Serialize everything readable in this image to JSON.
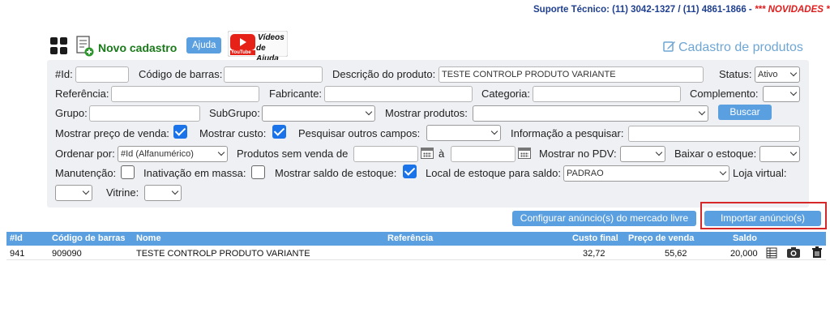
{
  "support": {
    "label": "Suporte Técnico: (11) 3042-1327 / (11) 4861-1866 - ",
    "news": "*** NOVIDADES ***"
  },
  "toolbar": {
    "new_label": "Novo cadastro",
    "help_label": "Ajuda",
    "videos_brand": "YouTube",
    "videos_line1": "Vídeos",
    "videos_line2": "de Ajuda"
  },
  "page_title": "Cadastro de produtos",
  "filters": {
    "id_label": "#Id:",
    "barcode_label": "Código de barras:",
    "description_label": "Descrição do produto:",
    "description_value": "TESTE CONTROLP PRODUTO VARIANTE",
    "status_label": "Status:",
    "status_value": "Ativo",
    "reference_label": "Referência:",
    "manufacturer_label": "Fabricante:",
    "category_label": "Categoria:",
    "complement_label": "Complemento:",
    "group_label": "Grupo:",
    "subgroup_label": "SubGrupo:",
    "show_products_label": "Mostrar produtos:",
    "search_button": "Buscar",
    "show_sale_price_label": "Mostrar preço de venda:",
    "show_sale_price": true,
    "show_cost_label": "Mostrar custo:",
    "show_cost": true,
    "search_other_label": "Pesquisar outros campos:",
    "info_search_label": "Informação a pesquisar:",
    "order_by_label": "Ordenar por:",
    "order_by_value": "#Id (Alfanumérico)",
    "no_sale_label": "Produtos sem venda de",
    "date_sep": "à",
    "show_pdv_label": "Mostrar no PDV:",
    "lower_stock_label": "Baixar o estoque:",
    "maintenance_label": "Manutenção:",
    "maintenance": false,
    "mass_inactivation_label": "Inativação em massa:",
    "mass_inactivation": false,
    "show_stock_label": "Mostrar saldo de estoque:",
    "show_stock": true,
    "stock_location_label": "Local de estoque para saldo:",
    "stock_location_value": "PADRAO",
    "virtual_store_label": "Loja virtual:",
    "showcase_label": "Vitrine:"
  },
  "actions": {
    "configure_ads": "Configurar anúncio(s) do mercado livre",
    "import_ads": "Importar anúncio(s)"
  },
  "table": {
    "headers": {
      "id": "#Id",
      "barcode": "Código de barras",
      "name": "Nome",
      "reference": "Referência",
      "final_cost": "Custo final",
      "sale_price": "Preço de venda",
      "balance": "Saldo"
    },
    "rows": [
      {
        "id": "941",
        "barcode": "909090",
        "name": "TESTE CONTROLP PRODUTO VARIANTE",
        "reference": "",
        "final_cost": "32,72",
        "sale_price": "55,62",
        "balance": "20,000"
      }
    ]
  },
  "colors": {
    "accent": "#5a9fdf",
    "highlight": "#d62828",
    "news": "#e21b1b"
  }
}
